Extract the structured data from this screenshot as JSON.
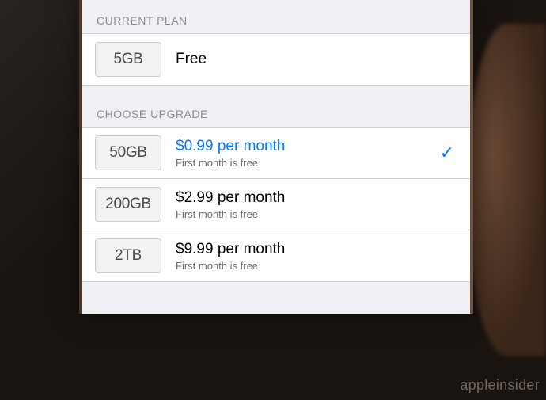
{
  "sections": {
    "current_plan_header": "CURRENT PLAN",
    "choose_upgrade_header": "CHOOSE UPGRADE"
  },
  "current_plan": {
    "storage": "5GB",
    "label": "Free"
  },
  "upgrades": [
    {
      "storage": "50GB",
      "price": "$0.99 per month",
      "note": "First month is free",
      "selected": true
    },
    {
      "storage": "200GB",
      "price": "$2.99 per month",
      "note": "First month is free",
      "selected": false
    },
    {
      "storage": "2TB",
      "price": "$9.99 per month",
      "note": "First month is free",
      "selected": false
    }
  ],
  "watermark": "appleinsider"
}
